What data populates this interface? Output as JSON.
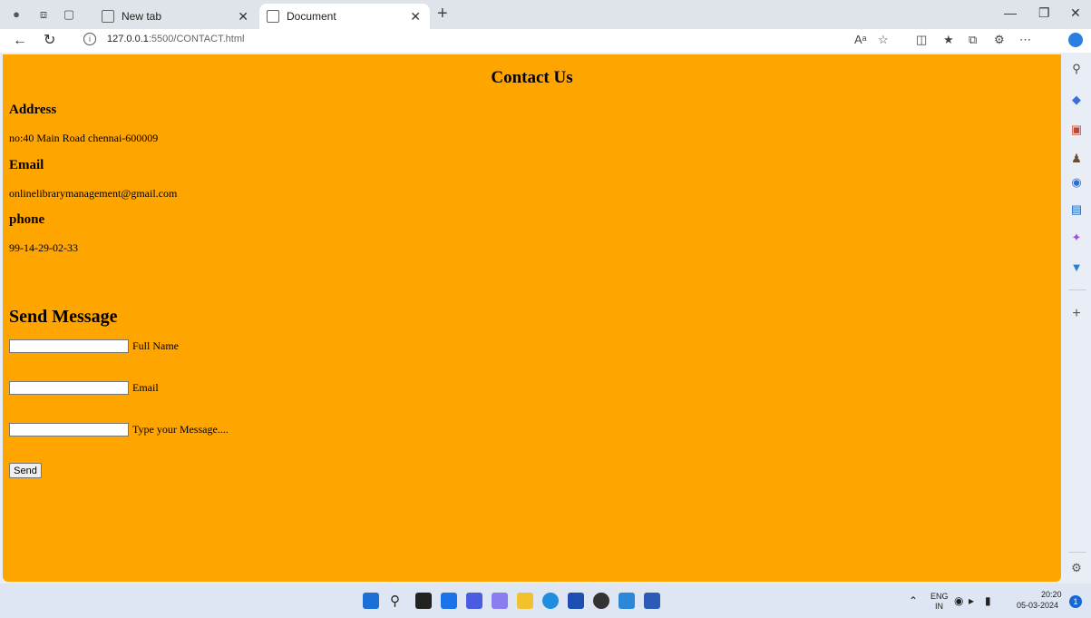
{
  "browser": {
    "tabs": [
      {
        "label": "New tab",
        "active": false
      },
      {
        "label": "Document",
        "active": true
      }
    ],
    "url_host": "127.0.0.1",
    "url_rest": ":5500/CONTACT.html"
  },
  "page": {
    "title": "Contact Us",
    "address_heading": "Address",
    "address_value": "no:40 Main Road chennai-600009",
    "email_heading": "Email",
    "email_value": "onlinelibrarymanagement@gmail.com",
    "phone_heading": "phone",
    "phone_value": "99-14-29-02-33",
    "form_heading": "Send Message",
    "fields": [
      {
        "label": "Full Name",
        "value": ""
      },
      {
        "label": "Email",
        "value": ""
      },
      {
        "label": "Type your Message....",
        "value": ""
      }
    ],
    "send_label": "Send",
    "background_color": "#ffa500"
  },
  "taskbar": {
    "lang_top": "ENG",
    "lang_bottom": "IN",
    "time": "20:20",
    "date": "05-03-2024",
    "notification_count": "1"
  }
}
